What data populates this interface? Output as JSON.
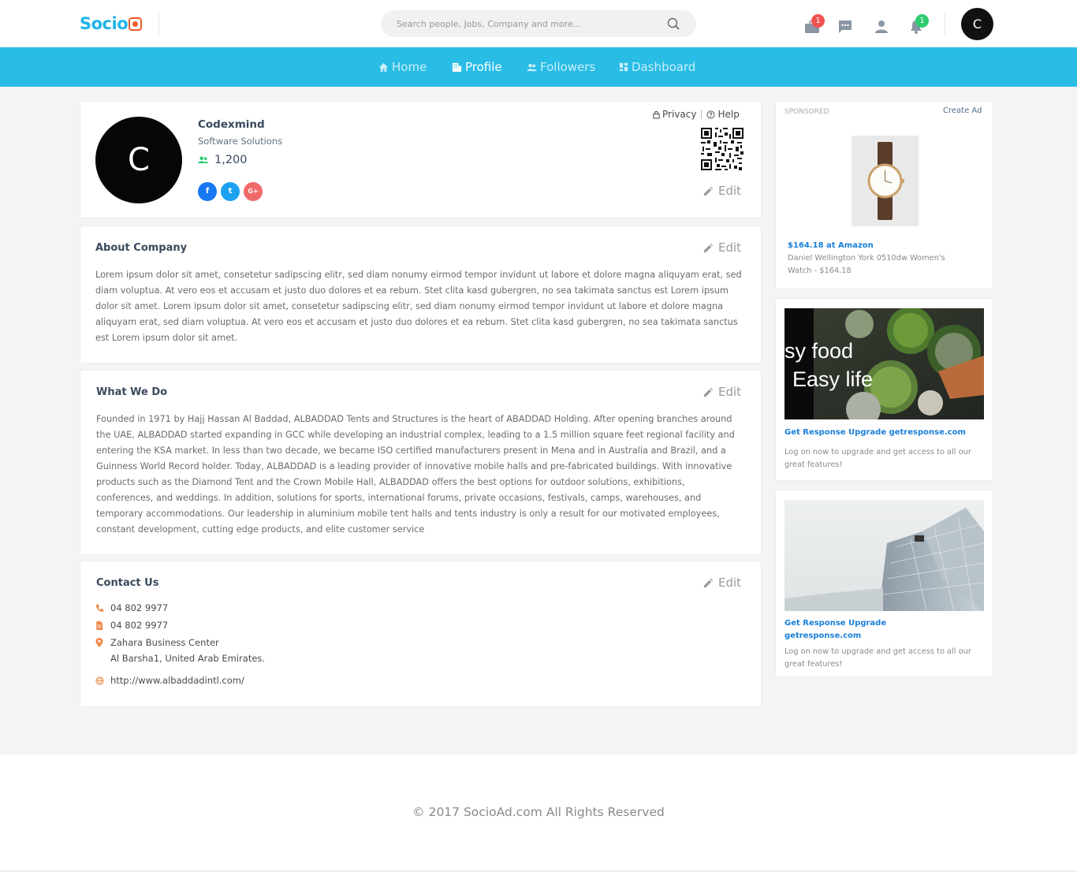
{
  "header": {
    "logo_text": "Socio",
    "search_placeholder": "Search people, Jobs, Company and more...",
    "notifications": {
      "jobs_badge": "1",
      "alerts_badge": "1"
    },
    "user_initial": "C",
    "icons": [
      "briefcase-icon",
      "chat-icon",
      "user-icon",
      "bell-icon",
      "search-icon"
    ]
  },
  "nav": {
    "items": [
      {
        "label": "Home",
        "icon": "home-icon"
      },
      {
        "label": "Profile",
        "icon": "building-icon",
        "active": true
      },
      {
        "label": "Followers",
        "icon": "users-icon"
      },
      {
        "label": "Dashboard",
        "icon": "dashboard-icon"
      }
    ]
  },
  "profile": {
    "avatar_initial": "C",
    "name": "Codexmind",
    "subtitle": "Software Solutions",
    "followers_count": "1,200",
    "socials": [
      "f",
      "t",
      "G+"
    ],
    "privacy_label": "Privacy",
    "help_label": "Help",
    "edit_label": "Edit"
  },
  "about": {
    "title": "About Company",
    "edit_label": "Edit",
    "text": "Lorem ipsum dolor sit amet, consetetur sadipscing elitr, sed diam nonumy eirmod tempor invidunt ut labore et dolore magna aliquyam erat, sed diam voluptua. At vero eos et accusam et justo duo dolores et ea rebum. Stet clita kasd gubergren, no sea takimata sanctus est Lorem ipsum dolor sit amet. Lorem ipsum dolor sit amet, consetetur sadipscing elitr, sed diam nonumy eirmod tempor invidunt ut labore et dolore magna aliquyam erat, sed diam voluptua. At vero eos et accusam et justo duo dolores et ea rebum. Stet clita kasd gubergren, no sea takimata sanctus est Lorem ipsum dolor sit amet."
  },
  "what_we_do": {
    "title": "What We Do",
    "edit_label": "Edit",
    "text": "Founded in 1971 by Hajj Hassan Al Baddad, ALBADDAD Tents and Structures is the heart of ABADDAD Holding. After opening branches around the UAE, ALBADDAD started expanding in GCC while developing an industrial complex, leading to a 1.5 million square feet regional facility and entering the KSA market. In less than two decade, we became ISO certified manufacturers present in Mena and in Australia and Brazil, and a Guinness World Record holder. Today, ALBADDAD is a leading provider of innovative mobile halls and pre-fabricated buildings. With innovative products such as the Diamond Tent and the Crown Mobile Hall, ALBADDAD offers the best options for outdoor solutions, exhibitions, conferences, and weddings. In addition, solutions for sports, international forums, private occasions, festivals, camps, warehouses, and temporary accommodations. Our leadership in aluminium mobile tent halls and tents industry is only a result for our motivated employees, constant development, cutting edge products, and elite customer service"
  },
  "contact": {
    "title": "Contact Us",
    "edit_label": "Edit",
    "phone": "04 802 9977",
    "fax": "04 802 9977",
    "address_line1": "Zahara Business Center",
    "address_line2": "Al Barsha1, United Arab Emirates.",
    "website": "http://www.albaddadintl.com/"
  },
  "sidebar": {
    "ad1": {
      "sponsored_label": "SPONSORED",
      "create_ad_label": "Create Ad",
      "link": "$164.18 at Amazon",
      "text": "Daniel Wellington York 0510dw Women's Watch - $164.18"
    },
    "ad2": {
      "image_text_line1": "sy food",
      "image_text_line2": "Easy life",
      "link": "Get Response Upgrade getresponse.com",
      "text": "Log on now to upgrade and get access to all our great features!"
    },
    "ad3": {
      "link": "Get Response Upgrade getresponse.com",
      "text": "Log on now to upgrade and get access to all our great features!"
    }
  },
  "footer": {
    "text": "© 2017 SocioAd.com All Rights Reserved"
  },
  "colors": {
    "accent": "#29bde6",
    "logo_orange": "#f05a28",
    "badge_red": "#f05252",
    "badge_green": "#2ecc71",
    "link_blue": "#1a7fd8",
    "facebook": "#1877f2",
    "twitter": "#1da1f2",
    "google": "#f06a6a"
  }
}
